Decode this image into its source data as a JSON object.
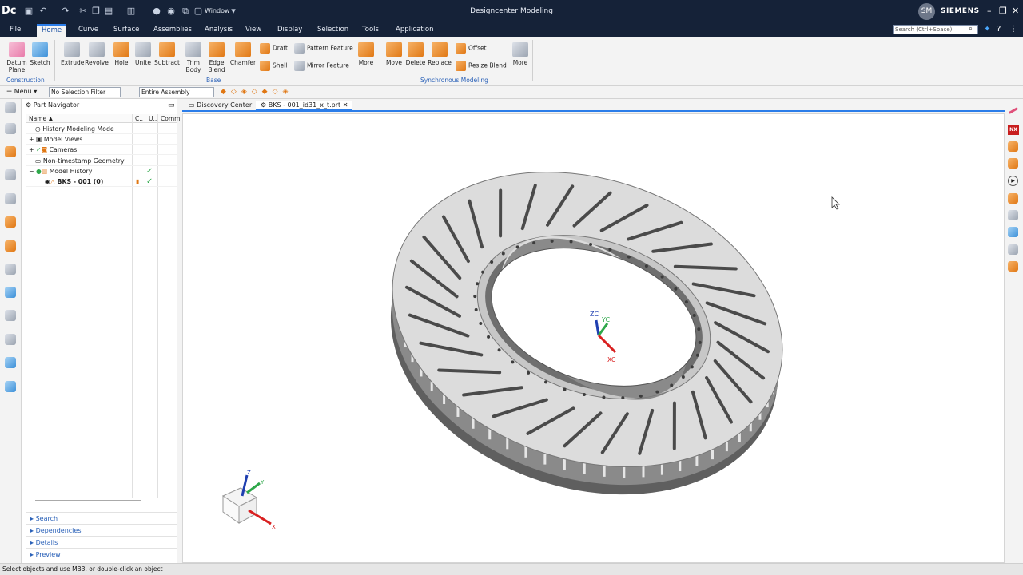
{
  "app": {
    "logo": "Dc",
    "title": "Designcenter Modeling",
    "window_menu": "Window",
    "user_initials": "SM",
    "brand": "SIEMENS"
  },
  "menu_tabs": [
    "File",
    "Home",
    "Curve",
    "Surface",
    "Assemblies",
    "Analysis",
    "View",
    "Display",
    "Selection",
    "Tools",
    "Application"
  ],
  "search": {
    "placeholder": "Search (Ctrl+Space)"
  },
  "ribbon": {
    "datum_plane": "Datum Plane",
    "sketch": "Sketch",
    "extrude": "Extrude",
    "revolve": "Revolve",
    "hole": "Hole",
    "unite": "Unite",
    "subtract": "Subtract",
    "trim_body": "Trim Body",
    "edge_blend": "Edge Blend",
    "chamfer": "Chamfer",
    "draft": "Draft",
    "shell": "Shell",
    "pattern_feature": "Pattern Feature",
    "mirror_feature": "Mirror Feature",
    "more": "More",
    "move": "Move",
    "delete": "Delete",
    "replace": "Replace",
    "offset": "Offset",
    "resize_blend": "Resize Blend",
    "more2": "More",
    "group_construction": "Construction",
    "group_base": "Base",
    "group_sync": "Synchronous Modeling"
  },
  "selection_bar": {
    "menu": "Menu",
    "filter": "No Selection Filter",
    "scope": "Entire Assembly"
  },
  "navigator": {
    "title": "Part Navigator",
    "columns": [
      "Name",
      "C..",
      "U..",
      "Comm"
    ],
    "rows": [
      {
        "label": "History Modeling Mode"
      },
      {
        "label": "Model Views"
      },
      {
        "label": "Cameras"
      },
      {
        "label": "Non-timestamp Geometry"
      },
      {
        "label": "Model History"
      },
      {
        "label": "BKS - 001 (0)"
      }
    ],
    "accordions": [
      "Search",
      "Dependencies",
      "Details",
      "Preview"
    ]
  },
  "doc_tabs": [
    "Discovery Center",
    "BKS - 001_id31_x_t.prt"
  ],
  "viewport": {
    "csys_labels": {
      "zc": "ZC",
      "yc": "YC",
      "xc": "XC"
    },
    "triad_labels": {
      "z": "Z",
      "y": "Y",
      "x": "X"
    }
  },
  "status_text": "Select objects and use MB3, or double-click an object",
  "colors": {
    "titlebar": "#152238",
    "accent": "#2b7de9",
    "part_fill": "#d9d9d9",
    "part_dark": "#6e6e6e"
  }
}
